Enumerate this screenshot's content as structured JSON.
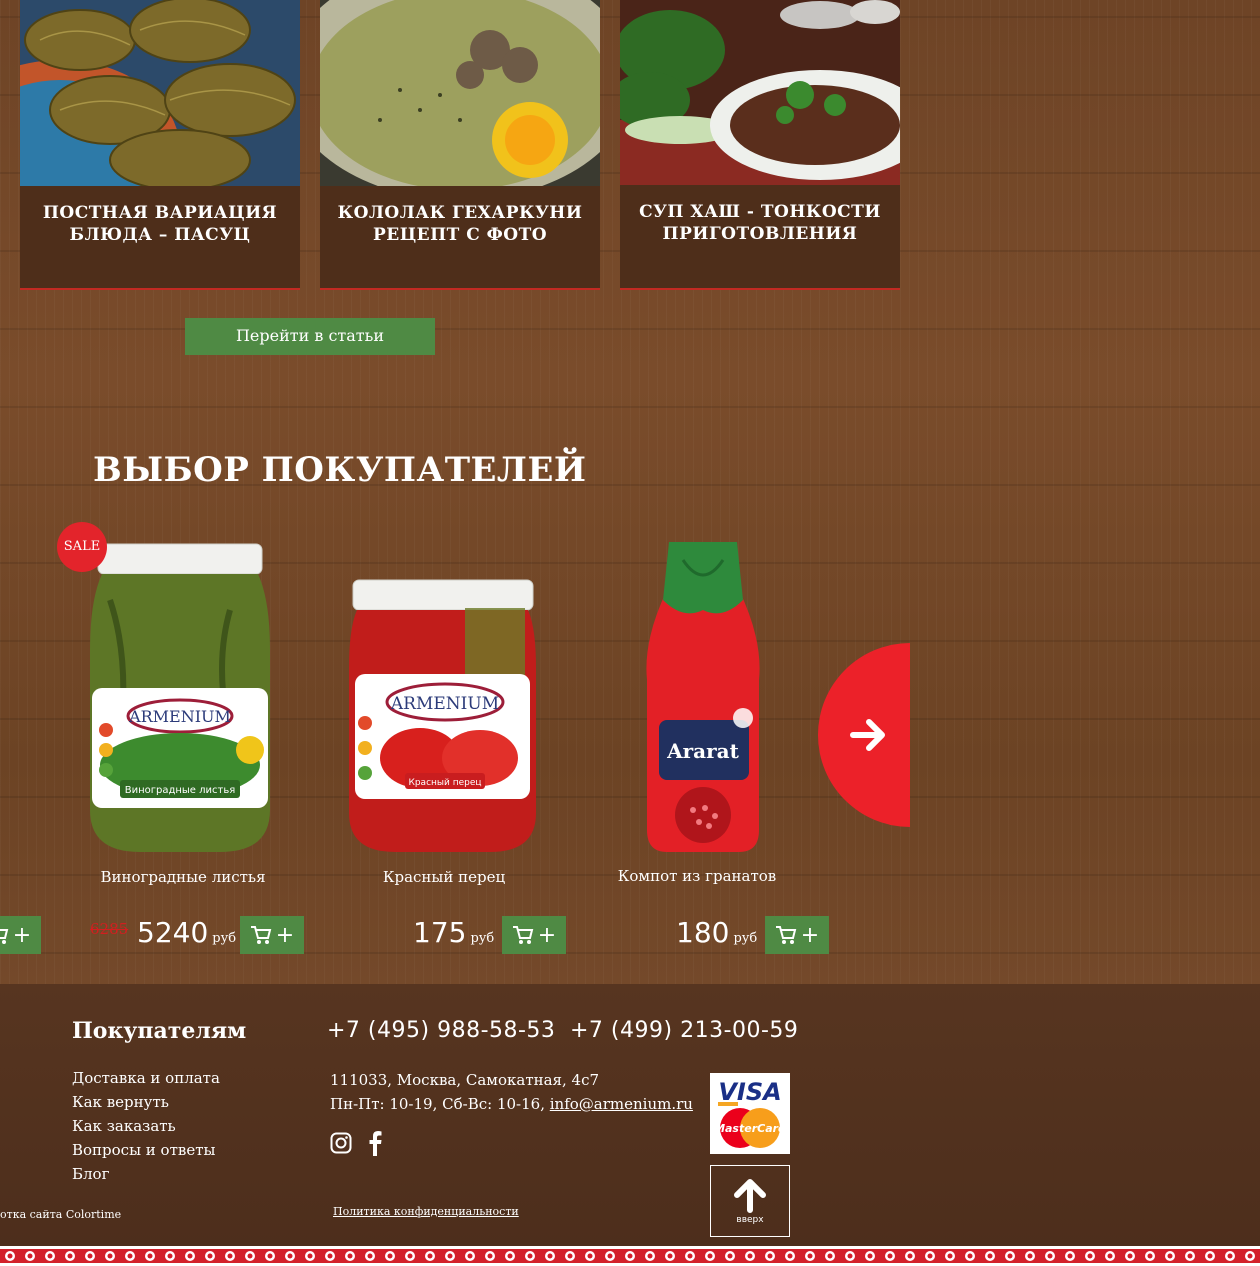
{
  "articles": [
    {
      "title": "ПОСТНАЯ ВАРИАЦИЯ БЛЮДА – ПАСУЦ"
    },
    {
      "title": "КОЛОЛАК ГЕХАРКУНИ РЕЦЕПТ С ФОТО"
    },
    {
      "title": "СУП ХАШ - ТОНКОСТИ ПРИГОТОВЛЕНИЯ"
    }
  ],
  "articles_button": "Перейти в статьи",
  "section_title": "ВЫБОР ПОКУПАТЕЛЕЙ",
  "sale_badge": "SALE",
  "products": [
    {
      "name": "Виноградные листья",
      "old_price": "6285",
      "price": "5240",
      "currency": "руб",
      "label_brand": "ARMENIUM",
      "label_text": "Виноградные листья"
    },
    {
      "name": "Красный перец",
      "price": "175",
      "currency": "руб",
      "label_brand": "ARMENIUM",
      "label_text": "Красный перец"
    },
    {
      "name": "Компот из гранатов",
      "price": "180",
      "currency": "руб",
      "label_brand": "Ararat"
    }
  ],
  "cart_plus": "+",
  "footer": {
    "heading": "Покупателям",
    "menu": [
      "Доставка и оплата",
      "Как вернуть",
      "Как заказать",
      "Вопросы и ответы",
      "Блог"
    ],
    "phone1": "+7 (495) 988-58-53",
    "phone2": "+7 (499) 213-00-59",
    "address": "111033, Москва, Самокатная, 4с7",
    "hours": "Пн-Пт: 10-19, Сб-Вс: 10-16,",
    "email": "info@armenium.ru",
    "payment": {
      "visa": "VISA",
      "mastercard": "MasterCard"
    },
    "up_label": "вверх",
    "dev_credit": "отка сайта Colortime",
    "privacy": "Политика конфиденциальности"
  },
  "colors": {
    "green": "#4f8a44",
    "red": "#e3242b",
    "card": "#4e2e1a"
  }
}
